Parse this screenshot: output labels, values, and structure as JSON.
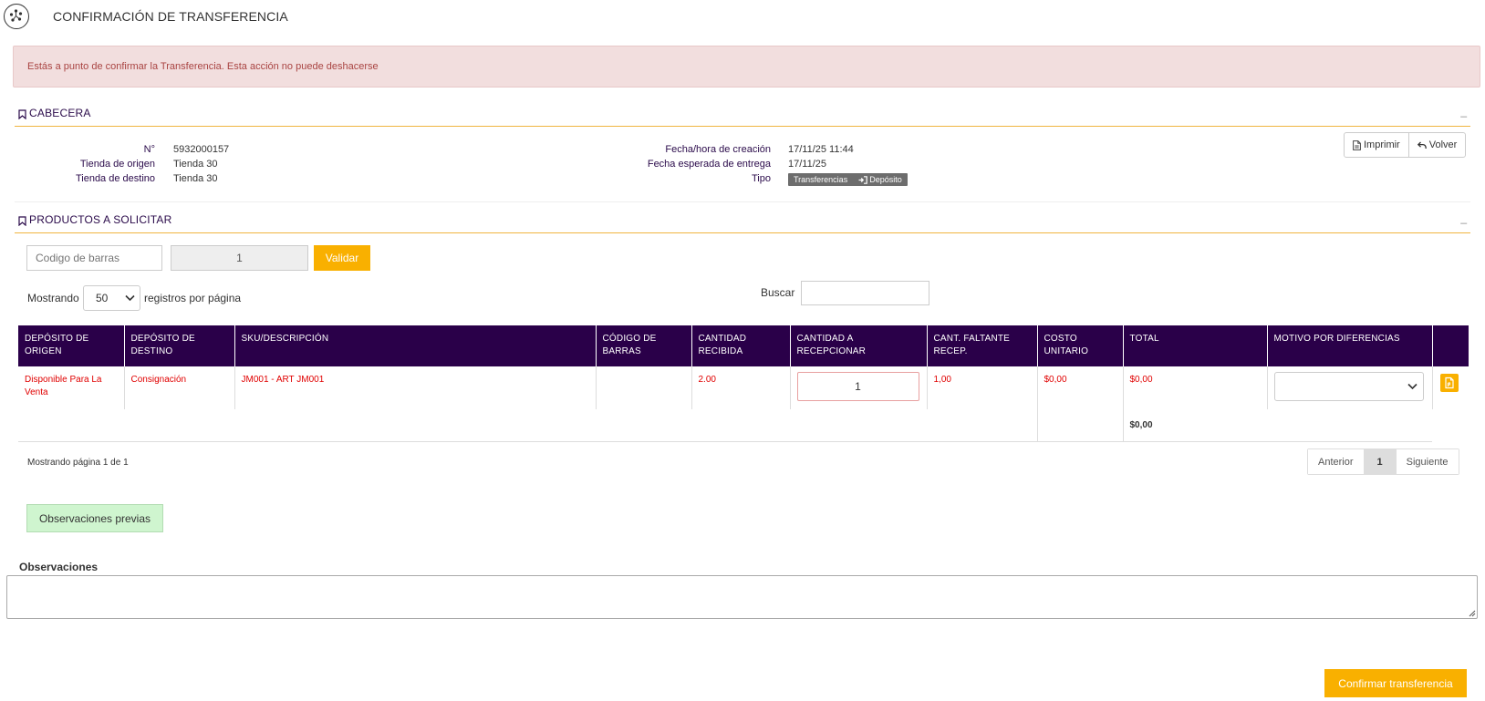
{
  "page": {
    "title": "CONFIRMACIÓN DE TRANSFERENCIA"
  },
  "alert": {
    "text": "Estás a punto de confirmar la Transferencia. Esta acción no puede deshacerse"
  },
  "cabecera": {
    "title": "CABECERA",
    "collapse_glyph": "_",
    "left": [
      {
        "label": "N°",
        "value": "5932000157"
      },
      {
        "label": "Tienda de origen",
        "value": "Tienda 30"
      },
      {
        "label": "Tienda de destino",
        "value": "Tienda 30"
      }
    ],
    "right": [
      {
        "label": "Fecha/hora de creación",
        "value": "17/11/25 11:44"
      },
      {
        "label": "Fecha esperada de entrega",
        "value": "17/11/25"
      },
      {
        "label": "Tipo",
        "badge_main": "Transferencias",
        "badge_sub": "Depósito"
      }
    ],
    "buttons": {
      "print": "Imprimir",
      "back": "Volver"
    }
  },
  "productos": {
    "title": "PRODUCTOS A SOLICITAR",
    "collapse_glyph": "_",
    "barcode_placeholder": "Codigo de barras",
    "qty_value": "1",
    "validate_label": "Validar",
    "length": {
      "prefix": "Mostrando",
      "value": "50",
      "suffix": "registros por página"
    },
    "search_label": "Buscar",
    "search_value": ""
  },
  "table": {
    "headers": [
      "DEPÓSITO DE ORIGEN",
      "DEPÓSITO DE DESTINO",
      "SKU/DESCRIPCIÓN",
      "CÓDIGO DE BARRAS",
      "CANTIDAD RECIBIDA",
      "CANTIDAD A RECEPCIONAR",
      "CANT. FALTANTE RECEP.",
      "COSTO UNITARIO",
      "TOTAL",
      "MOTIVO POR DIFERENCIAS",
      ""
    ],
    "rows": [
      {
        "origen": "Disponible Para La Venta",
        "destino": "Consignación",
        "sku": "JM001 - ART JM001",
        "codigo": "",
        "recibida": "2.00",
        "recepcionar": "1",
        "faltante": "1,00",
        "costo": "$0,00",
        "total": "$0,00",
        "motivo": ""
      }
    ],
    "grand_total": "$0,00"
  },
  "pagination": {
    "info": "Mostrando página 1 de 1",
    "prev": "Anterior",
    "current": "1",
    "next": "Siguiente"
  },
  "observaciones_previas": "Observaciones previas",
  "observaciones": {
    "label": "Observaciones",
    "value": ""
  },
  "confirm_label": "Confirmar transferencia",
  "colors": {
    "accent": "#f9b000",
    "header_bg": "#2a0049",
    "alert_bg": "#f2dede",
    "alert_text": "#a94442",
    "row_text": "#e00000",
    "obs_prev_bg": "#cff5cf"
  }
}
